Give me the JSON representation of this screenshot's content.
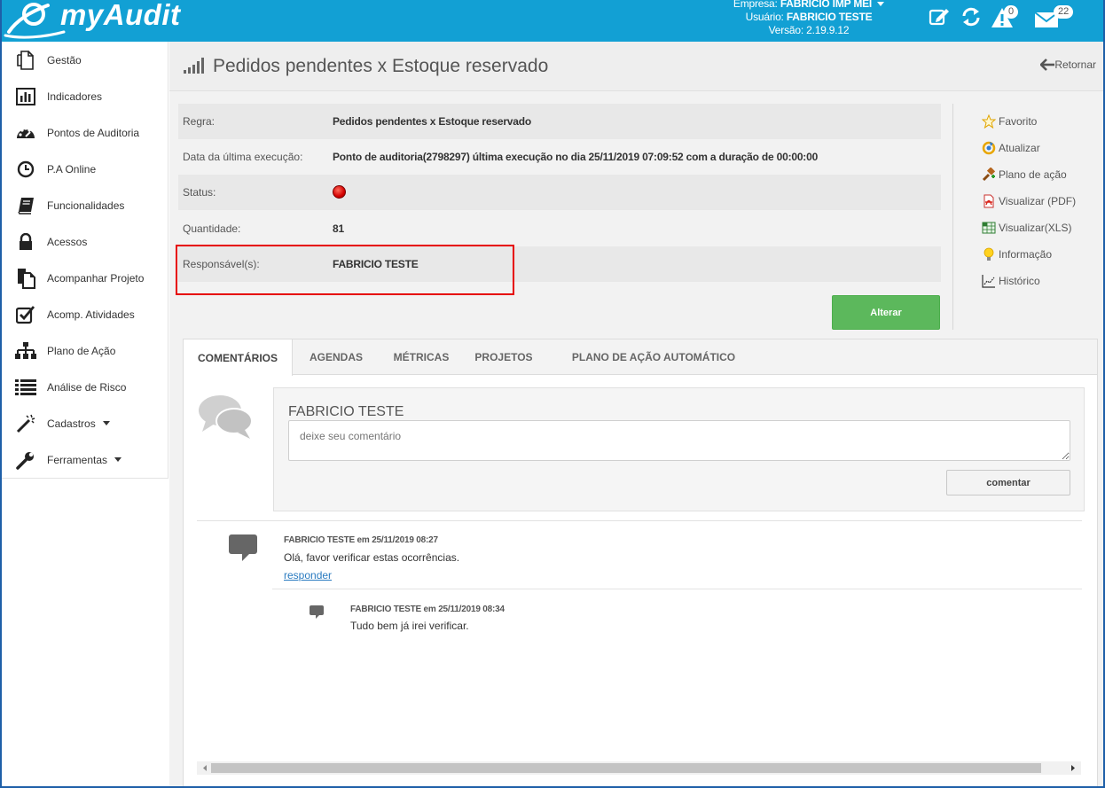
{
  "header": {
    "logo_text": "myAudit",
    "empresa_label": "Empresa:",
    "empresa_value": "FABRICIO IMP MEI",
    "usuario_label": "Usuário:",
    "usuario_value": "FABRICIO TESTE",
    "versao_label": "Versão:",
    "versao_value": "2.19.9.12",
    "alerts_count": "0",
    "messages_count": "22",
    "accent_color": "#12a0d4"
  },
  "sidebar": {
    "items": [
      {
        "label": "Gestão",
        "icon": "copy-icon"
      },
      {
        "label": "Indicadores",
        "icon": "bar-chart-icon"
      },
      {
        "label": "Pontos de Auditoria",
        "icon": "dashboard-icon"
      },
      {
        "label": "P.A Online",
        "icon": "clock-icon"
      },
      {
        "label": "Funcionalidades",
        "icon": "book-icon"
      },
      {
        "label": "Acessos",
        "icon": "lock-icon"
      },
      {
        "label": "Acompanhar Projeto",
        "icon": "files-icon"
      },
      {
        "label": "Acomp. Atividades",
        "icon": "checkbox-icon"
      },
      {
        "label": "Plano de Ação",
        "icon": "sitemap-icon"
      },
      {
        "label": "Análise de Risco",
        "icon": "list-icon"
      },
      {
        "label": "Cadastros",
        "icon": "magic-wand-icon"
      },
      {
        "label": "Ferramentas",
        "icon": "wrench-icon"
      }
    ]
  },
  "page": {
    "title": "Pedidos pendentes x Estoque reservado",
    "back_label": "Retornar"
  },
  "info": {
    "regra_label": "Regra:",
    "regra_value": "Pedidos pendentes x Estoque reservado",
    "data_label": "Data da última execução:",
    "data_value": "Ponto de auditoria(2798297) última execução no dia 25/11/2019 07:09:52 com a duração de 00:00:00",
    "status_label": "Status:",
    "status_color": "#d30000",
    "quantidade_label": "Quantidade:",
    "quantidade_value": "81",
    "responsavel_label": "Responsável(s):",
    "responsavel_value": "FABRICIO TESTE",
    "alterar_label": "Alterar"
  },
  "actions": {
    "favorito": "Favorito",
    "atualizar": "Atualizar",
    "plano": "Plano de ação",
    "pdf": "Visualizar (PDF)",
    "xls": "Visualizar(XLS)",
    "informacao": "Informação",
    "historico": "Histórico"
  },
  "tabs": {
    "comentarios": "COMENTÁRIOS",
    "agendas": "AGENDAS",
    "metricas": "MÉTRICAS",
    "projetos": "PROJETOS",
    "plano_auto": "PLANO DE AÇÃO AUTOMÁTICO"
  },
  "comment_form": {
    "user": "FABRICIO TESTE",
    "placeholder": "deixe seu comentário",
    "button": "comentar"
  },
  "comments": [
    {
      "head": "FABRICIO TESTE em 25/11/2019 08:27",
      "text": "Olá, favor verificar estas ocorrências.",
      "reply": "responder"
    },
    {
      "head": "FABRICIO TESTE em 25/11/2019 08:34",
      "text": "Tudo bem já irei verificar."
    }
  ]
}
